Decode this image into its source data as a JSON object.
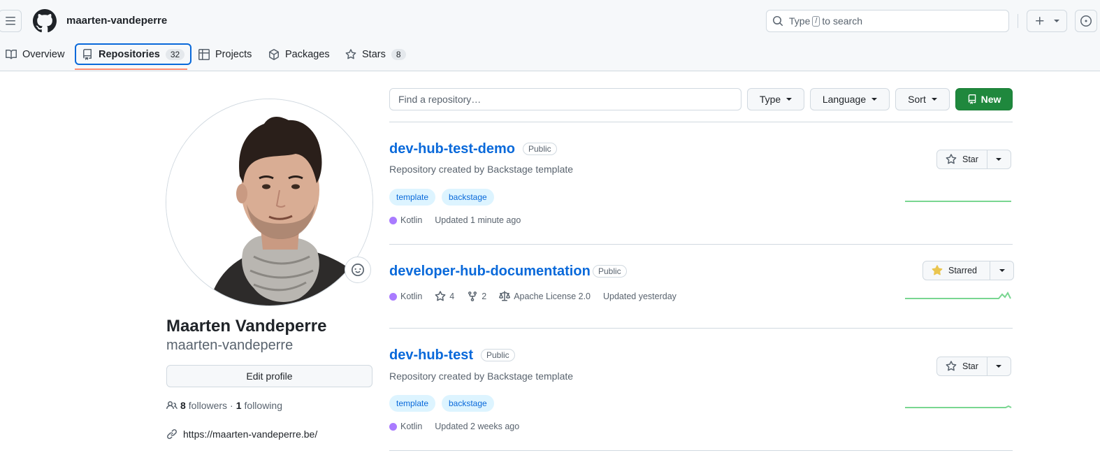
{
  "header": {
    "username": "maarten-vandeperre",
    "search_prefix": "Type",
    "search_key": "/",
    "search_suffix": "to search"
  },
  "tabs": [
    {
      "label": "Overview",
      "icon": "book-icon"
    },
    {
      "label": "Repositories",
      "count": "32",
      "icon": "repo-icon",
      "active": true
    },
    {
      "label": "Projects",
      "icon": "table-icon"
    },
    {
      "label": "Packages",
      "icon": "package-icon"
    },
    {
      "label": "Stars",
      "count": "8",
      "icon": "star-icon"
    }
  ],
  "profile": {
    "name": "Maarten Vandeperre",
    "login": "maarten-vandeperre",
    "edit_label": "Edit profile",
    "followers_count": "8",
    "followers_label": "followers",
    "separator": "·",
    "following_count": "1",
    "following_label": "following",
    "website": "https://maarten-vandeperre.be/"
  },
  "filters": {
    "find_placeholder": "Find a repository…",
    "type_label": "Type",
    "language_label": "Language",
    "sort_label": "Sort",
    "new_label": "New"
  },
  "repos": [
    {
      "name": "dev-hub-test-demo",
      "visibility": "Public",
      "description": "Repository created by Backstage template",
      "topics": [
        "template",
        "backstage"
      ],
      "language": "Kotlin",
      "language_color": "#a97bff",
      "updated": "Updated 1 minute ago",
      "star_label": "Star"
    },
    {
      "name": "developer-hub-documentation",
      "visibility": "Public",
      "language": "Kotlin",
      "language_color": "#a97bff",
      "stars": "4",
      "forks": "2",
      "license": "Apache License 2.0",
      "updated": "Updated yesterday",
      "star_label": "Starred"
    },
    {
      "name": "dev-hub-test",
      "visibility": "Public",
      "description": "Repository created by Backstage template",
      "topics": [
        "template",
        "backstage"
      ],
      "language": "Kotlin",
      "language_color": "#a97bff",
      "updated": "Updated 2 weeks ago",
      "star_label": "Star"
    }
  ],
  "colors": {
    "accent": "#0969da",
    "primary_button": "#1f883d",
    "tab_underline": "#fd8c73",
    "starred_icon": "#eac54f",
    "sparkline": "#40c463"
  }
}
